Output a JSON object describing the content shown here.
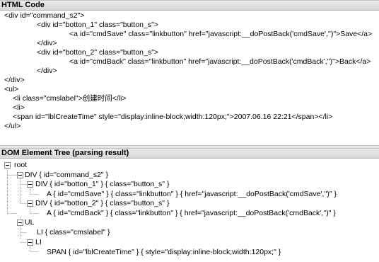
{
  "html_panel": {
    "title": "HTML Code",
    "lines": [
      "<div id=\"command_s2\">",
      "<div id=\"botton_1\" class=\"button_s\">",
      "<a id=\"cmdSave\" class=\"linkbutton\" href=\"javascript:__doPostBack('cmdSave','')\">Save</a>",
      "</div>",
      "<div id=\"botton_2\" class=\"button_s\">",
      "<a id=\"cmdBack\" class=\"linkbutton\" href=\"javascript:__doPostBack('cmdBack','')\">Back</a>",
      "</div>",
      "</div>",
      "<ul>",
      "<li class=\"cmslabel\">创建时间</li>",
      "<li>",
      "<span id=\"lblCreateTime\" style=\"display:inline-block;width:120px;\">2007.06.16 22:21</span></li>",
      "</ul>"
    ]
  },
  "dom_panel": {
    "title": "DOM Element Tree (parsing result)",
    "nodes": [
      "root",
      "DIV { id=\"command_s2\" }",
      "DIV { id=\"botton_1\" } { class=\"button_s\" }",
      "A { id=\"cmdSave\" } { class=\"linkbutton\" } { href=\"javascript:__doPostBack('cmdSave','')\" }",
      "DIV { id=\"botton_2\" } { class=\"button_s\" }",
      "A { id=\"cmdBack\" } { class=\"linkbutton\" } { href=\"javascript:__doPostBack('cmdBack','')\" }",
      "UL",
      "LI { class=\"cmslabel\" }",
      "LI",
      "SPAN { id=\"lblCreateTime\" } { style=\"display:inline-block;width:120px;\" }"
    ]
  }
}
